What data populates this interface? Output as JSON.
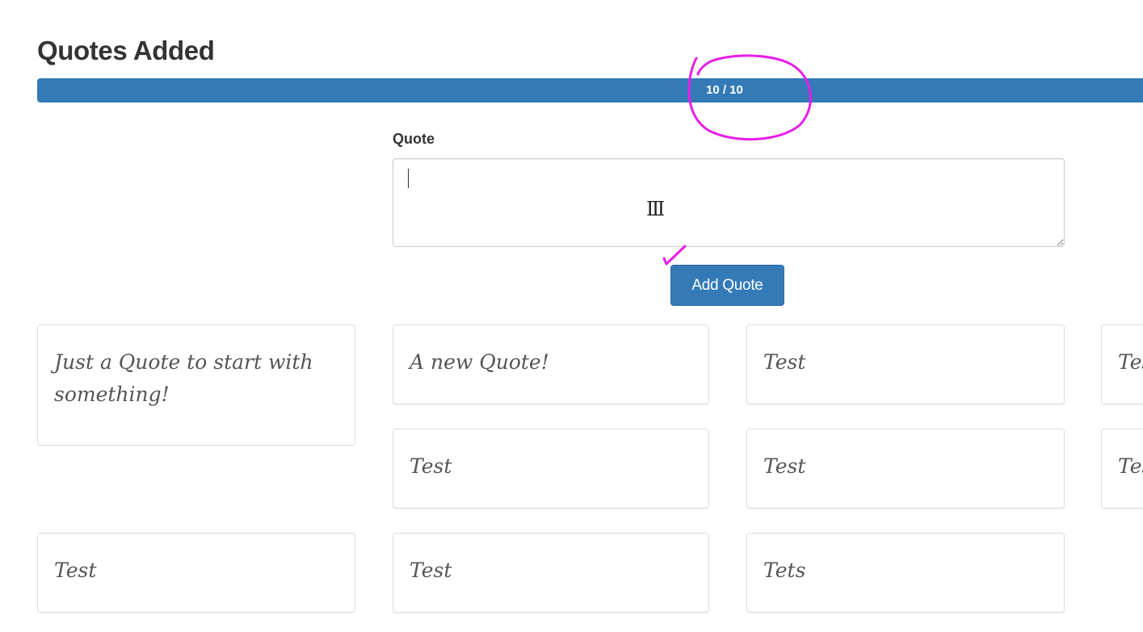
{
  "header": {
    "title": "Quotes Added"
  },
  "progress": {
    "label": "10 / 10",
    "value": 10,
    "max": 10,
    "color": "#337ab7"
  },
  "form": {
    "label": "Quote",
    "value": "",
    "button_label": "Add Quote"
  },
  "quotes": [
    "Just a Quote to start with something!",
    "A new Quote!",
    "Test",
    "Test",
    "Test",
    "Test",
    "Test",
    "Test",
    "Test",
    "Tets"
  ],
  "annotation": {
    "color": "#e81ee8"
  }
}
